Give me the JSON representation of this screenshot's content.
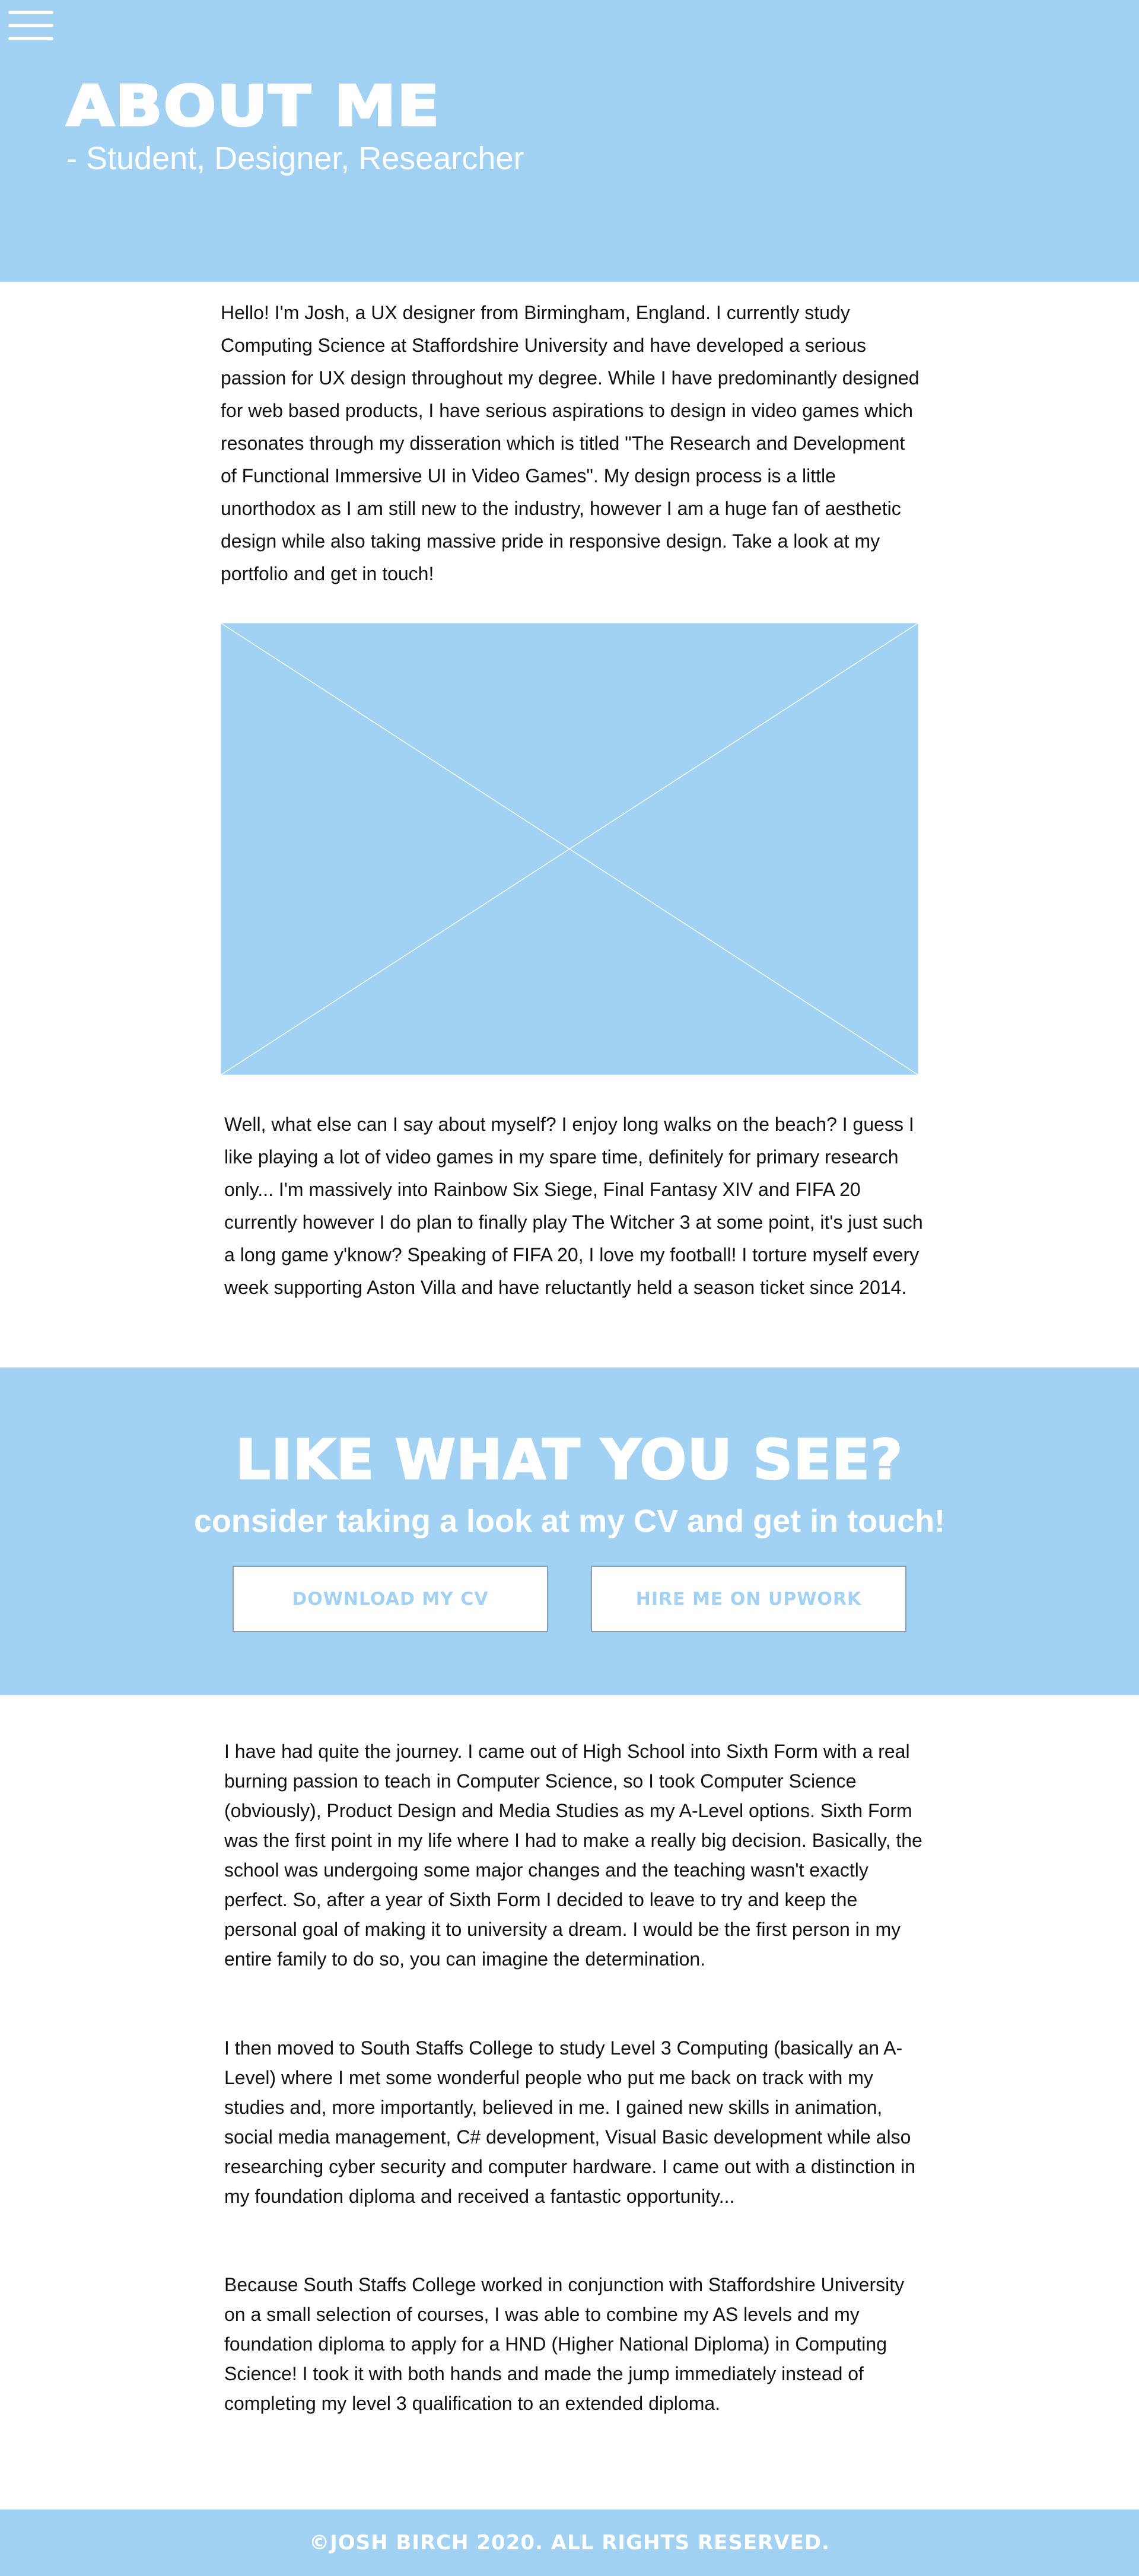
{
  "colors": {
    "accent": "#a1d2f4",
    "text": "#111111",
    "background": "#ffffff",
    "button_border": "#8aa0b0"
  },
  "nav": {
    "menu_icon": "hamburger-menu-icon"
  },
  "hero": {
    "title": "ABOUT ME",
    "subtitle": "- Student, Designer, Researcher"
  },
  "intro": {
    "text": "Hello! I'm Josh, a UX designer from Birmingham, England. I currently study Computing Science at Staffordshire University and have developed a serious passion for UX design throughout my degree. While I have predominantly designed for web based products, I have serious aspirations to design in video games which resonates through my disseration which is titled \"The Research and Development of Functional Immersive UI in Video Games\". My design process is a little unorthodox as I am still new to the industry, however I am a huge fan of aesthetic design while also taking massive pride in responsive design. Take a look at my portfolio and get in touch!"
  },
  "image_placeholder": {
    "icon": "image-placeholder-icon"
  },
  "about_more": {
    "text": "Well, what else can I say about myself? I enjoy long walks on the beach? I guess I like playing a lot of video games in my spare time, definitely for primary research only... I'm massively into Rainbow Six Siege, Final Fantasy XIV and FIFA 20 currently however I do plan to finally play The Witcher 3 at some point, it's just such a long game y'know? Speaking of FIFA 20, I love my football! I torture myself every week supporting Aston Villa and have reluctantly held a season ticket since 2014."
  },
  "cta": {
    "title": "LIKE WHAT YOU SEE?",
    "subtitle": "consider taking a look at my CV and get in touch!",
    "download_cv_label": "DOWNLOAD MY CV",
    "hire_upwork_label": "HIRE ME ON UPWORK"
  },
  "journey": {
    "paragraphs": [
      "I have had quite the journey. I came out of High School into Sixth Form with a real burning passion to teach in Computer Science, so I took Computer Science (obviously), Product Design and Media Studies as my A-Level options. Sixth Form was the first point in my life where I had to make a really big decision. Basically, the school was undergoing some major changes and the teaching wasn't exactly perfect. So, after a year of Sixth Form I decided to leave to try and keep the personal goal of making it to university a dream. I would be the first person in my entire family to do so, you can imagine the determination.",
      "I then moved to South Staffs College to study Level 3 Computing (basically an A-Level) where I met some wonderful people who put me back on track with my studies and, more importantly, believed in me. I gained new skills in animation, social media management, C# development, Visual Basic development while also researching cyber security and computer hardware. I came out with a distinction in my foundation diploma and received a fantastic opportunity...",
      "Because South Staffs College worked in conjunction with Staffordshire University on a small selection of courses, I was able to combine my AS levels and my foundation diploma to apply for a HND (Higher National Diploma) in Computing Science! I took it with both hands and made the jump immediately instead of completing my level 3 qualification to an extended diploma."
    ]
  },
  "footer": {
    "text": "©JOSH BIRCH 2020. ALL RIGHTS RESERVED."
  }
}
